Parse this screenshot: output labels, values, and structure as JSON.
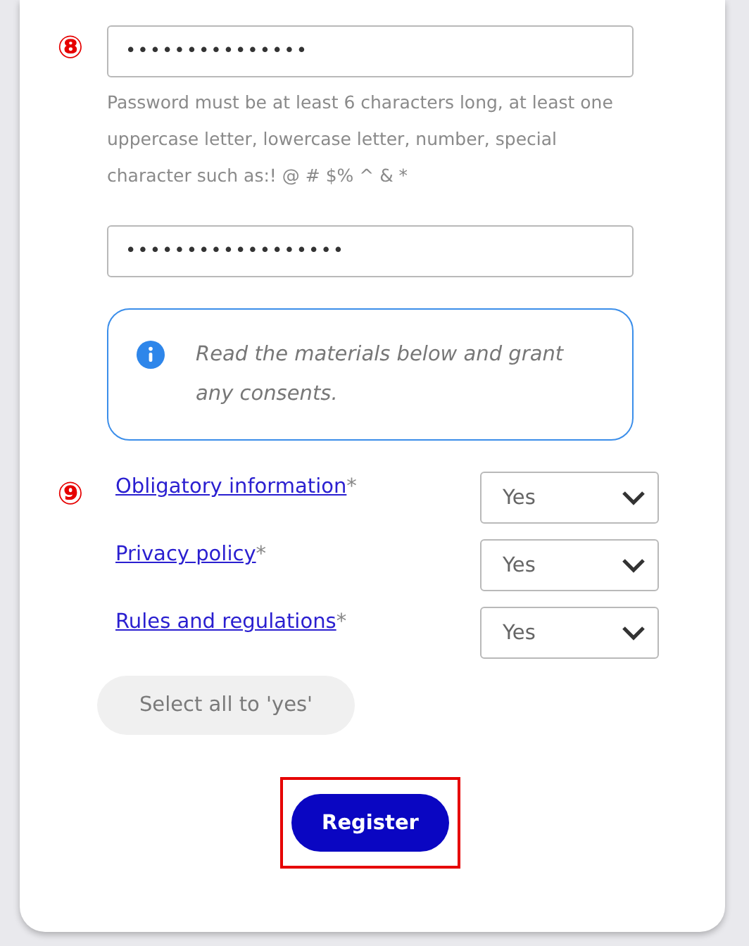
{
  "password": {
    "marker": "⑧",
    "value": "•••••••••••••••",
    "hint": "Password must be at least 6 characters long, at least one uppercase letter, lowercase letter, number, special character such as:! @ # $% ^ & *"
  },
  "confirm_password": {
    "value": "••••••••••••••••••"
  },
  "info": {
    "text": "Read the materials below and grant any consents."
  },
  "consents": {
    "marker": "⑨",
    "items": [
      {
        "label": "Obligatory information",
        "required": "*",
        "value": "Yes"
      },
      {
        "label": "Privacy policy",
        "required": "*",
        "value": "Yes"
      },
      {
        "label": "Rules and regulations",
        "required": "*",
        "value": "Yes"
      }
    ]
  },
  "select_all": {
    "label": "Select all to 'yes'"
  },
  "register": {
    "label": "Register",
    "highlighted": true
  }
}
